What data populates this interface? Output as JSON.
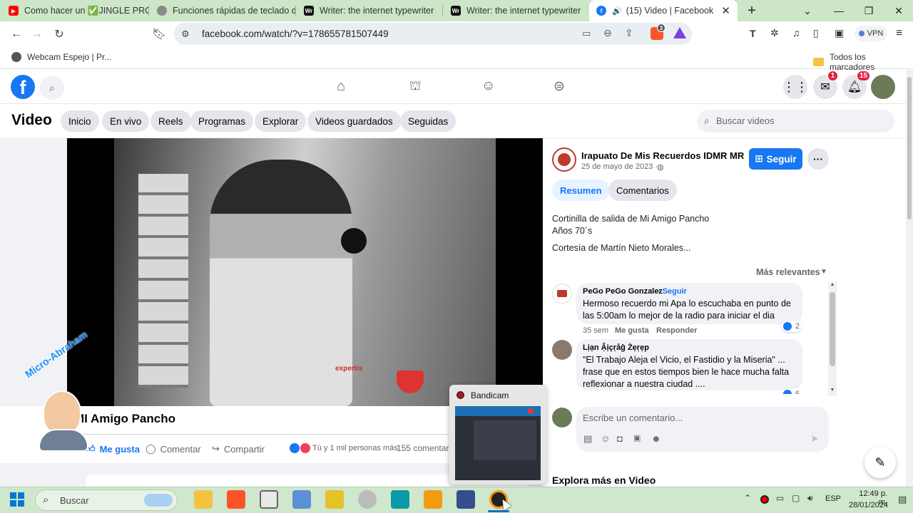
{
  "tabs": [
    {
      "title": "Como hacer un ✅JINGLE PRO",
      "favicon": "youtube-icon",
      "color": "#ff0000"
    },
    {
      "title": "Funciones rápidas de teclado del",
      "favicon": "apple-icon",
      "color": "#777777"
    },
    {
      "title": "Writer: the internet typewriter",
      "favicon": "writer-icon",
      "color": "#111111"
    },
    {
      "title": "Writer: the internet typewriter",
      "favicon": "writer-icon",
      "color": "#111111"
    },
    {
      "title": "(15) Video | Facebook",
      "favicon": "facebook-icon",
      "color": "#1877f2"
    }
  ],
  "address": {
    "url": "facebook.com/watch/?v=178655781507449",
    "brave_count": "3",
    "vpn_label": "VPN"
  },
  "bookmarks": {
    "first": "Webcam Espejo | Pr...",
    "all": "Todos los marcadores"
  },
  "fb": {
    "messenger_badge": "1",
    "notif_badge": "15",
    "section_title": "Video",
    "nav": [
      "Inicio",
      "En vivo",
      "Reels",
      "Programas",
      "Explorar",
      "Videos guardados",
      "Seguidas"
    ],
    "search_placeholder": "Buscar videos"
  },
  "video": {
    "title": "MI Amigo Pancho",
    "watermark": "Micro-Abraham",
    "logo_text": "expertis",
    "like": "Me gusta",
    "comment": "Comentar",
    "share": "Compartir",
    "reactions": "Tú y 1 mil personas más",
    "comments_count": "155 comentario"
  },
  "post": {
    "page_name": "Irapuato De Mis Recuerdos IDMR MR",
    "date": "25 de mayo de 2023 ·",
    "follow": "Seguir",
    "tab_summary": "Resumen",
    "tab_comments": "Comentarios",
    "desc1": "Cortinilla de salida de Mi Amigo Pancho",
    "desc2": "Años 70´s",
    "desc3": "Cortesía de Martín Nieto Morales...",
    "sort": "Más relevantes",
    "write_placeholder": "Escribe un comentario...",
    "explore": "Explora más en Video"
  },
  "comments": [
    {
      "author": "PeGo PeGo Gonzalez",
      "follow": "· Seguir",
      "line1": "Hermoso recuerdo mi Apa lo escuchaba en punto de",
      "line2": "las 5:00am lo mejor de la radio para iniciar el dia",
      "line3": "",
      "time": "35 sem",
      "like": "Me gusta",
      "reply": "Responder",
      "reactions": "2"
    },
    {
      "author": "Lịạn Ậịçṛåĝ Żẹṛẹp",
      "follow": "",
      "line1": "\"El Trabajo Aleja el Vicio, el Fastidio y la Miseria\" ...",
      "line2": "frase que en estos tiempos bien le hace mucha falta",
      "line3": "reflexionar a nuestra ciudad ....",
      "time": "",
      "like": "",
      "reply": "",
      "reactions": "6"
    }
  ],
  "bandicam": {
    "title": "Bandicam"
  },
  "taskbar": {
    "search": "Buscar",
    "lang": "ESP",
    "time": "12:49 p. m.",
    "date": "28/01/2024"
  }
}
